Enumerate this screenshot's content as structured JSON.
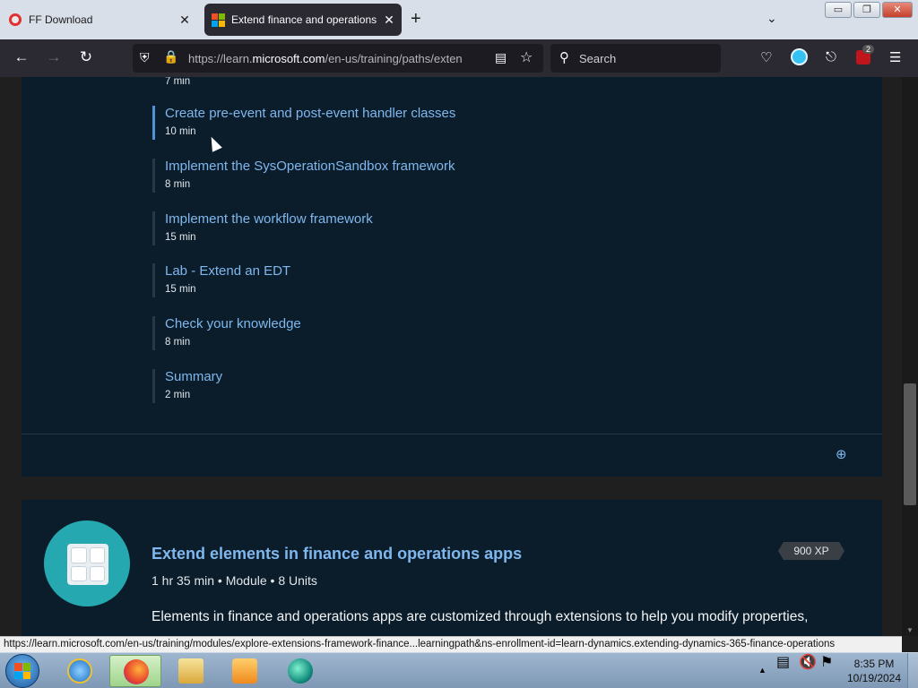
{
  "browser": {
    "tabs": [
      {
        "title": "FF Download",
        "close": "✕"
      },
      {
        "title": "Extend finance and operations ap",
        "close": "✕"
      }
    ],
    "new_tab": "+",
    "url_prefix": "https://learn.",
    "url_domain": "microsoft.com",
    "url_suffix": "/en-us/training/paths/exten",
    "search_placeholder": "Search",
    "extension_badge": "2",
    "window_controls": {
      "minimize": "▭",
      "maximize": "❐",
      "close": "✕"
    }
  },
  "units": [
    {
      "title": "",
      "duration": "7 min",
      "active": false
    },
    {
      "title": "Create pre-event and post-event handler classes",
      "duration": "10 min",
      "active": true
    },
    {
      "title": "Implement the SysOperationSandbox framework",
      "duration": "8 min",
      "active": false
    },
    {
      "title": "Implement the workflow framework",
      "duration": "15 min",
      "active": false
    },
    {
      "title": "Lab - Extend an EDT",
      "duration": "15 min",
      "active": false
    },
    {
      "title": "Check your knowledge",
      "duration": "8 min",
      "active": false
    },
    {
      "title": "Summary",
      "duration": "2 min",
      "active": false
    }
  ],
  "expand_icon": "⊕",
  "module": {
    "title": "Extend elements in finance and operations apps",
    "meta": "1 hr 35 min • Module • 8 Units",
    "xp": "900 XP",
    "description": "Elements in finance and operations apps are customized through extensions to help you modify properties,"
  },
  "status_url": "https://learn.microsoft.com/en-us/training/modules/explore-extensions-framework-finance...learningpath&ns-enrollment-id=learn-dynamics.extending-dynamics-365-finance-operations",
  "taskbar": {
    "time": "8:35 PM",
    "date": "10/19/2024"
  },
  "colors": {
    "link": "#7fb7ee",
    "card_bg": "#0b1d2a",
    "active_bar": "#4f93d6"
  }
}
